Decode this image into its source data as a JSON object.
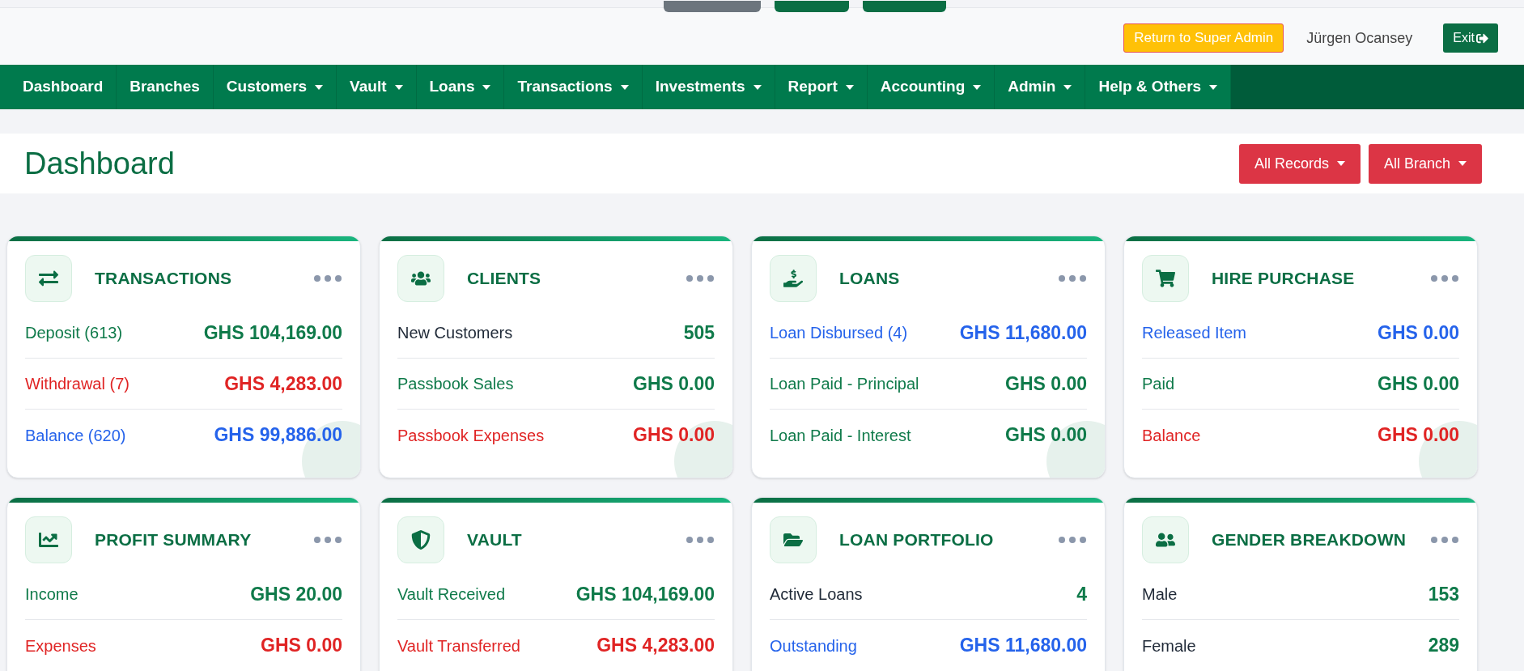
{
  "topbar": {
    "return_button": "Return to Super Admin",
    "user_name": "Jürgen Ocansey",
    "exit_button": "Exit"
  },
  "nav": [
    {
      "label": "Dashboard",
      "has_menu": false
    },
    {
      "label": "Branches",
      "has_menu": false
    },
    {
      "label": "Customers",
      "has_menu": true
    },
    {
      "label": "Vault",
      "has_menu": true
    },
    {
      "label": "Loans",
      "has_menu": true
    },
    {
      "label": "Transactions",
      "has_menu": true
    },
    {
      "label": "Investments",
      "has_menu": true
    },
    {
      "label": "Report",
      "has_menu": true
    },
    {
      "label": "Accounting",
      "has_menu": true
    },
    {
      "label": "Admin",
      "has_menu": true
    },
    {
      "label": "Help & Others",
      "has_menu": true
    }
  ],
  "header": {
    "title": "Dashboard",
    "filters": [
      "All Records",
      "All Branch"
    ]
  },
  "cards": [
    {
      "title": "TRANSACTIONS",
      "rows": [
        {
          "label": "Deposit (613)",
          "value": "GHS 104,169.00",
          "kind": "toned",
          "color": "#0f7a4a"
        },
        {
          "label": "Withdrawal (7)",
          "value": "GHS 4,283.00",
          "kind": "toned",
          "color": "#e02424"
        },
        {
          "label": "Balance (620)",
          "value": "GHS 99,886.00",
          "kind": "toned",
          "color": "#2563eb"
        }
      ]
    },
    {
      "title": "CLIENTS",
      "rows": [
        {
          "label": "New Customers",
          "value": "505",
          "kind": "plain",
          "color": "#0f7a4a"
        },
        {
          "label": "Passbook Sales",
          "value": "GHS 0.00",
          "kind": "toned",
          "color": "#0f7a4a"
        },
        {
          "label": "Passbook Expenses",
          "value": "GHS 0.00",
          "kind": "toned",
          "color": "#e02424"
        }
      ]
    },
    {
      "title": "LOANS",
      "rows": [
        {
          "label": "Loan Disbursed (4)",
          "value": "GHS 11,680.00",
          "kind": "toned",
          "color": "#2563eb"
        },
        {
          "label": "Loan Paid - Principal",
          "value": "GHS 0.00",
          "kind": "toned",
          "color": "#0f7a4a"
        },
        {
          "label": "Loan Paid - Interest",
          "value": "GHS 0.00",
          "kind": "toned",
          "color": "#0f7a4a"
        }
      ]
    },
    {
      "title": "HIRE PURCHASE",
      "rows": [
        {
          "label": "Released Item",
          "value": "GHS 0.00",
          "kind": "toned",
          "color": "#2563eb"
        },
        {
          "label": "Paid",
          "value": "GHS 0.00",
          "kind": "toned",
          "color": "#0f7a4a"
        },
        {
          "label": "Balance",
          "value": "GHS 0.00",
          "kind": "toned",
          "color": "#e02424"
        }
      ]
    },
    {
      "title": "PROFIT SUMMARY",
      "rows": [
        {
          "label": "Income",
          "value": "GHS 20.00",
          "kind": "toned",
          "color": "#0f7a4a"
        },
        {
          "label": "Expenses",
          "value": "GHS 0.00",
          "kind": "toned",
          "color": "#e02424"
        }
      ]
    },
    {
      "title": "VAULT",
      "rows": [
        {
          "label": "Vault Received",
          "value": "GHS 104,169.00",
          "kind": "toned",
          "color": "#0f7a4a"
        },
        {
          "label": "Vault Transferred",
          "value": "GHS 4,283.00",
          "kind": "toned",
          "color": "#e02424"
        }
      ]
    },
    {
      "title": "LOAN PORTFOLIO",
      "rows": [
        {
          "label": "Active Loans",
          "value": "4",
          "kind": "plain",
          "color": "#0f7a4a"
        },
        {
          "label": "Outstanding",
          "value": "GHS 11,680.00",
          "kind": "toned",
          "color": "#2563eb"
        }
      ]
    },
    {
      "title": "GENDER BREAKDOWN",
      "rows": [
        {
          "label": "Male",
          "value": "153",
          "kind": "plain",
          "color": "#0f7a4a"
        },
        {
          "label": "Female",
          "value": "289",
          "kind": "plain",
          "color": "#0f7a4a"
        }
      ]
    }
  ]
}
